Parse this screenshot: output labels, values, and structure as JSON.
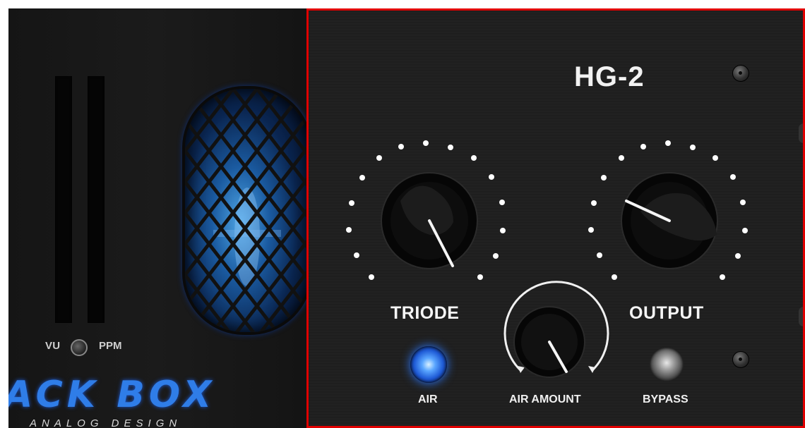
{
  "plugin": {
    "model_title": "HG-2",
    "selection_color": "#e00000",
    "accent_blue": "#2f7de8"
  },
  "meter": {
    "vu_label": "VU",
    "ppm_label": "PPM",
    "toggle_icon": "toggle-switch-icon"
  },
  "brand": {
    "logo_text": "ACK BOX",
    "sub_text": "ANALOG DESIGN"
  },
  "controls": {
    "triode_label": "TRIODE",
    "output_label": "OUTPUT",
    "air_label": "AIR",
    "air_amount_label": "AIR AMOUNT",
    "bypass_label": "BYPASS",
    "air_led_state": "on",
    "bypass_led_state": "off"
  }
}
